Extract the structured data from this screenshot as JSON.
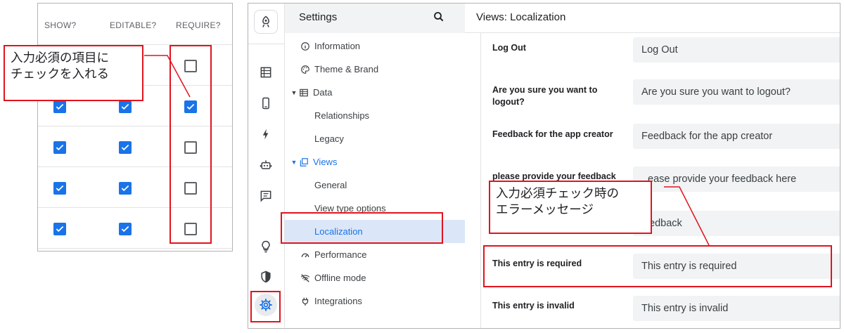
{
  "table": {
    "headers": {
      "show": "SHOW?",
      "editable": "EDITABLE?",
      "require": "REQUIRE?"
    },
    "rows": [
      {
        "show": null,
        "editable": null,
        "require": false
      },
      {
        "show": true,
        "editable": true,
        "require": true
      },
      {
        "show": true,
        "editable": true,
        "require": false
      },
      {
        "show": true,
        "editable": true,
        "require": false
      },
      {
        "show": true,
        "editable": true,
        "require": false
      }
    ]
  },
  "annotations": {
    "require_note_line1": "入力必須の項目に",
    "require_note_line2": "チェックを入れる",
    "error_note_line1": "入力必須チェック時の",
    "error_note_line2": "エラーメッセージ"
  },
  "sidebar": {
    "title": "Settings",
    "items": [
      {
        "label": "Information",
        "icon": "info-icon"
      },
      {
        "label": "Theme & Brand",
        "icon": "palette-icon"
      },
      {
        "label": "Data",
        "icon": "table-icon"
      },
      {
        "label": "Relationships"
      },
      {
        "label": "Legacy"
      },
      {
        "label": "Views",
        "icon": "views-icon"
      },
      {
        "label": "General"
      },
      {
        "label": "View type options"
      },
      {
        "label": "Localization"
      },
      {
        "label": "Performance",
        "icon": "speed-icon"
      },
      {
        "label": "Offline mode",
        "icon": "wifi-off-icon"
      },
      {
        "label": "Integrations",
        "icon": "plug-icon"
      }
    ]
  },
  "main": {
    "title": "Views: Localization",
    "fields": [
      {
        "label": "Log Out",
        "value": "Log Out"
      },
      {
        "label": "Are you sure you want to logout?",
        "value": "Are you sure you want to logout?"
      },
      {
        "label": "Feedback for the app creator",
        "value": "Feedback for the app creator"
      },
      {
        "label": "please provide your feedback",
        "value": "ease provide your feedback here"
      },
      {
        "label": "",
        "value": "edback"
      },
      {
        "label": "This entry is required",
        "value": "This entry is required"
      },
      {
        "label": "This entry is invalid",
        "value": "This entry is invalid"
      }
    ]
  },
  "colors": {
    "accent": "#1a73e8",
    "annotation": "#e0141e",
    "active_bg": "#dbe7f8"
  }
}
